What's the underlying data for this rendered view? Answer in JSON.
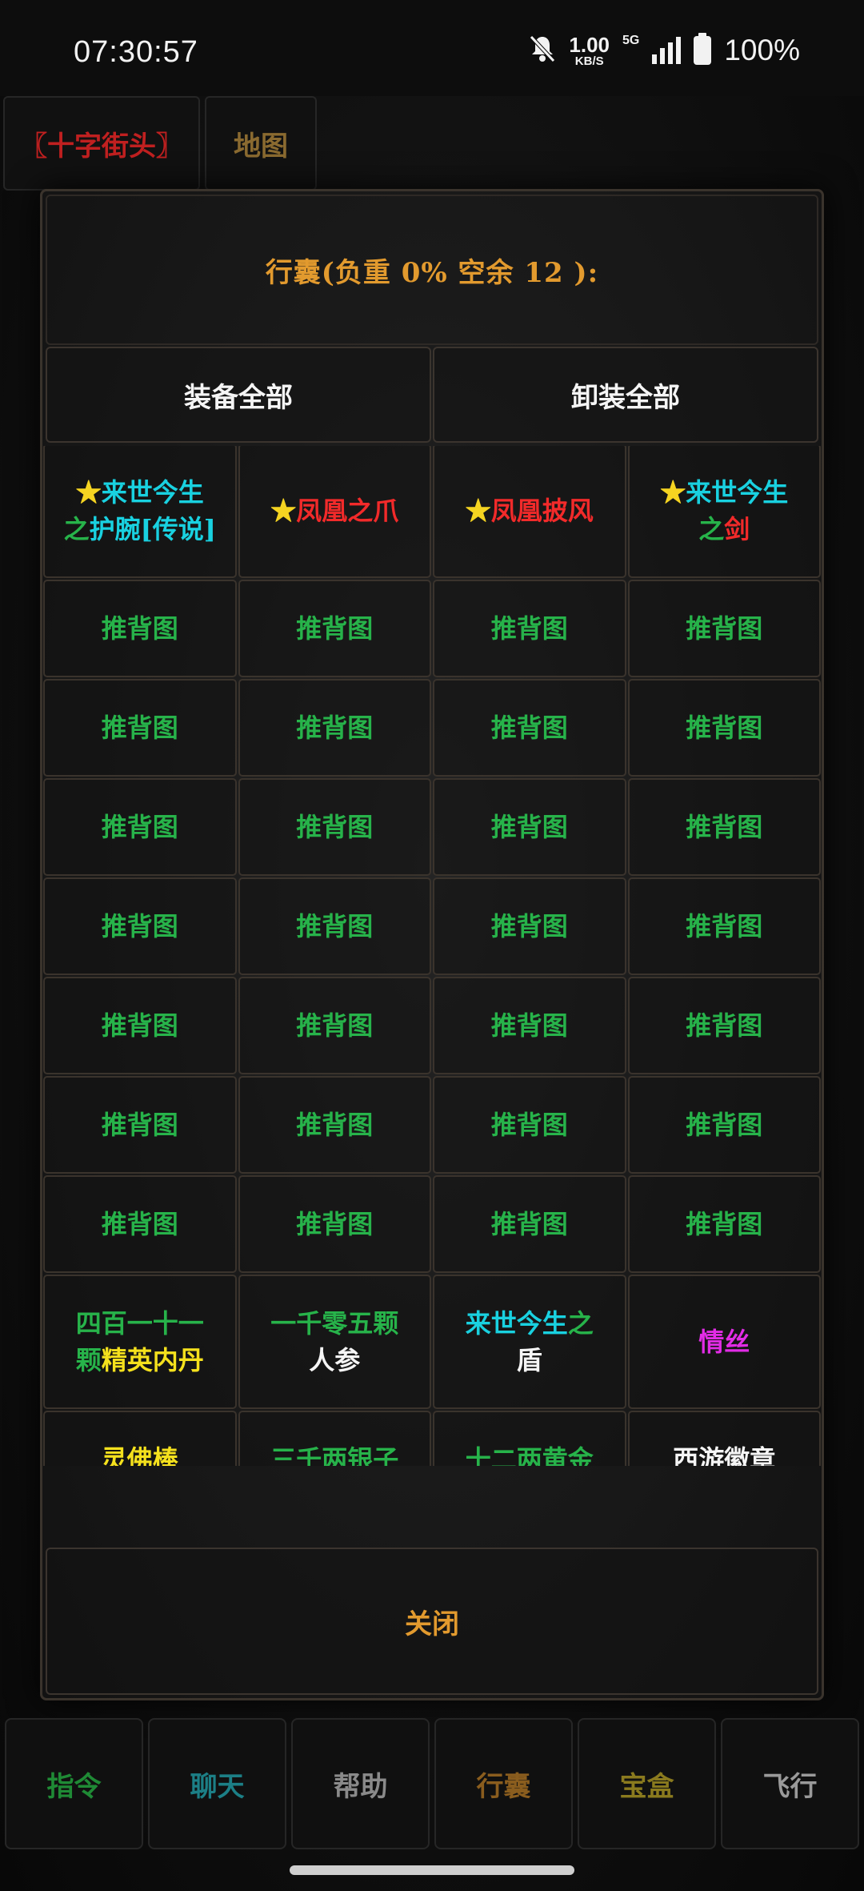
{
  "status_bar": {
    "time": "07:30:57",
    "speed_value": "1.00",
    "speed_unit": "KB/S",
    "network": "5G",
    "battery": "100%"
  },
  "background": {
    "top_tabs": [
      {
        "label": "〖十字街头〗",
        "color": "#c02020"
      },
      {
        "label": "地图",
        "color": "#8a6a30"
      }
    ]
  },
  "modal": {
    "title": "行囊(负重 0% 空余 12 ):",
    "equip_all": "装备全部",
    "unequip_all": "卸装全部",
    "close": "关闭"
  },
  "inventory": {
    "top_partial_count": 4,
    "special_row": [
      {
        "parts": [
          {
            "t": "★",
            "c": "y"
          },
          {
            "t": "来世今生",
            "c": "c"
          },
          {
            "t": "\n"
          },
          {
            "t": "之",
            "c": "g"
          },
          {
            "t": "护腕[传说]",
            "c": "c"
          }
        ]
      },
      {
        "parts": [
          {
            "t": "★",
            "c": "y"
          },
          {
            "t": "凤凰之爪",
            "c": "r"
          }
        ]
      },
      {
        "parts": [
          {
            "t": "★",
            "c": "y"
          },
          {
            "t": "凤凰披风",
            "c": "r"
          }
        ]
      },
      {
        "parts": [
          {
            "t": "★",
            "c": "y"
          },
          {
            "t": "来世今生",
            "c": "c"
          },
          {
            "t": "\n"
          },
          {
            "t": "之",
            "c": "g"
          },
          {
            "t": "剑",
            "c": "r"
          }
        ]
      }
    ],
    "repeat_label": "推背图",
    "repeat_rows": 7,
    "row_a": [
      {
        "parts": [
          {
            "t": "四百一十一",
            "c": "g"
          },
          {
            "t": "\n"
          },
          {
            "t": "颗",
            "c": "g"
          },
          {
            "t": "精英内丹",
            "c": "s"
          }
        ]
      },
      {
        "parts": [
          {
            "t": "一千零五颗",
            "c": "g"
          },
          {
            "t": "\n"
          },
          {
            "t": "人参",
            "c": "w"
          }
        ]
      },
      {
        "parts": [
          {
            "t": "来世今生",
            "c": "c"
          },
          {
            "t": "之",
            "c": "g"
          },
          {
            "t": "\n"
          },
          {
            "t": "盾",
            "c": "w"
          }
        ]
      },
      {
        "parts": [
          {
            "t": "情丝",
            "c": "m"
          }
        ]
      }
    ],
    "row_b": [
      {
        "parts": [
          {
            "t": "灵佛棒",
            "c": "s"
          }
        ]
      },
      {
        "parts": [
          {
            "t": "三千两银子",
            "c": "g"
          }
        ]
      },
      {
        "parts": [
          {
            "t": "十二两黄金",
            "c": "g"
          }
        ]
      },
      {
        "parts": [
          {
            "t": "西游徽章",
            "c": "w"
          }
        ]
      }
    ]
  },
  "bottom_nav": [
    {
      "label": "指令",
      "color": "#1f8a35"
    },
    {
      "label": "聊天",
      "color": "#1c7f86"
    },
    {
      "label": "帮助",
      "color": "#8a8a8a"
    },
    {
      "label": "行囊",
      "color": "#8a5d1e"
    },
    {
      "label": "宝盒",
      "color": "#8a7a1e"
    },
    {
      "label": "飞行",
      "color": "#9a9a9a"
    }
  ]
}
